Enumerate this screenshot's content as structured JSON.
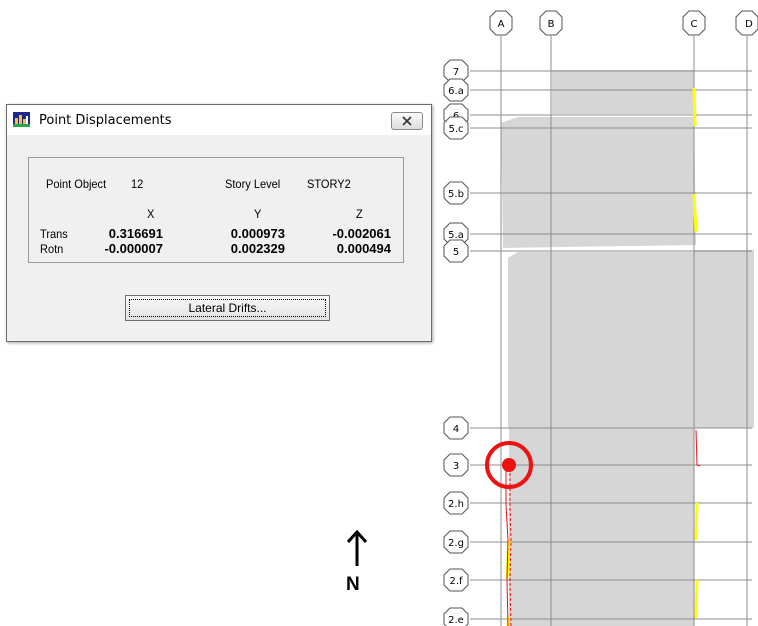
{
  "dialog": {
    "title": "Point Displacements",
    "point_object_label": "Point Object",
    "point_object_value": "12",
    "story_level_label": "Story Level",
    "story_level_value": "STORY2",
    "columns": [
      "X",
      "Y",
      "Z"
    ],
    "rows": [
      {
        "label": "Trans",
        "values": [
          "0.316691",
          "0.000973",
          "-0.002061"
        ]
      },
      {
        "label": "Rotn",
        "values": [
          "-0.000007",
          "0.002329",
          "0.000494"
        ]
      }
    ],
    "lateral_drifts_label": "Lateral Drifts..."
  },
  "grid": {
    "column_labels": [
      "A",
      "B",
      "C",
      "D"
    ],
    "row_labels": [
      "7",
      "6.a",
      "6",
      "5.c",
      "5.b",
      "5.a",
      "5",
      "4",
      "3",
      "2.h",
      "2.g",
      "2.f",
      "2.e"
    ]
  },
  "compass": {
    "label": "N"
  },
  "colors": {
    "selection": "#ee1111",
    "slab": "#d6d6d6",
    "highlight": "#ffff00",
    "grid_line": "#8c8c8c"
  }
}
